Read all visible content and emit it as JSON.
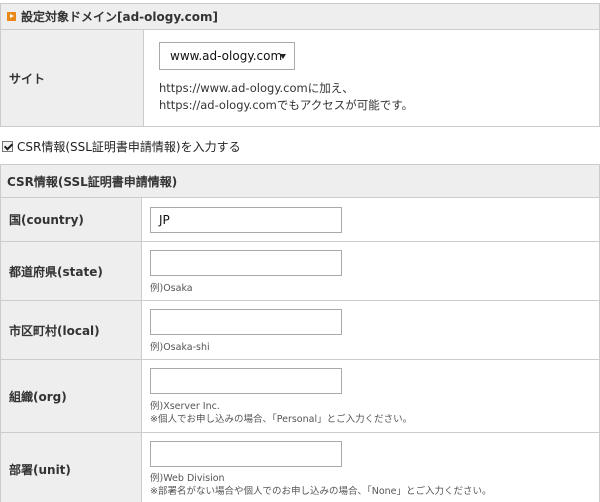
{
  "domain_section": {
    "title": "設定対象ドメイン[ad-ology.com]",
    "site_label": "サイト",
    "site_select_value": "www.ad-ology.com",
    "note_line1": "https://www.ad-ology.comに加え、",
    "note_line2": "https://ad-ology.comでもアクセスが可能です。"
  },
  "csr_checkbox": {
    "label": "CSR情報(SSL証明書申請情報)を入力する",
    "checked": true
  },
  "csr_section": {
    "title": "CSR情報(SSL証明書申請情報)",
    "rows": [
      {
        "label": "国(country)",
        "value": "JP",
        "example": "",
        "note": ""
      },
      {
        "label": "都道府県(state)",
        "value": "",
        "example": "例)Osaka",
        "note": ""
      },
      {
        "label": "市区町村(local)",
        "value": "",
        "example": "例)Osaka-shi",
        "note": ""
      },
      {
        "label": "組織(org)",
        "value": "",
        "example": "例)Xserver Inc.",
        "note": "※個人でお申し込みの場合、「Personal」とご入力ください。"
      },
      {
        "label": "部署(unit)",
        "value": "",
        "example": "例)Web Division",
        "note": "※部署名がない場合や個人でのお申し込みの場合、「None」とご入力ください。"
      }
    ]
  }
}
